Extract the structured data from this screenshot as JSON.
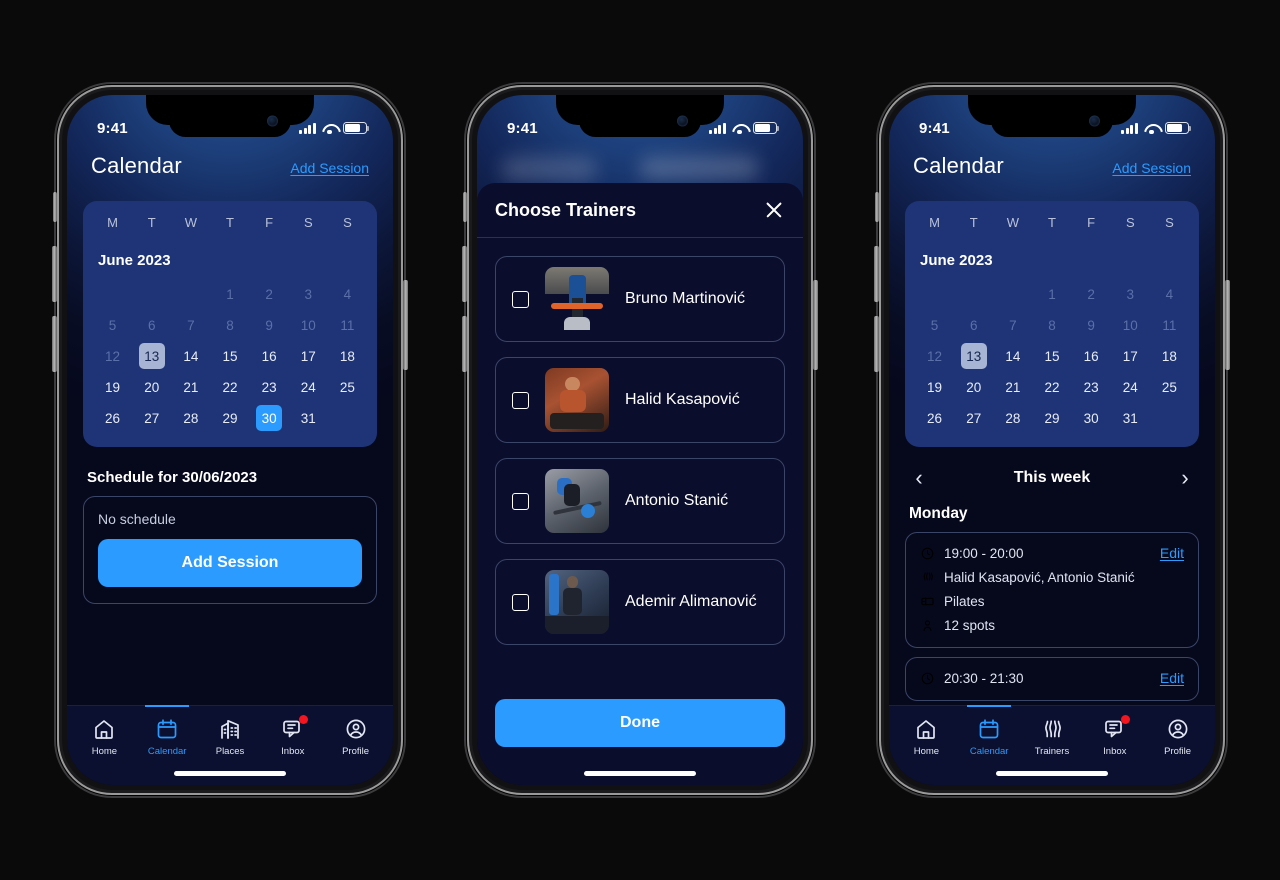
{
  "statusbar": {
    "time": "9:41",
    "signal_icon": "cellular-bars-icon",
    "wifi_icon": "wifi-icon",
    "battery_icon": "battery-icon"
  },
  "phone1": {
    "header": {
      "title": "Calendar",
      "add_session_link": "Add Session"
    },
    "calendar": {
      "weekdays": [
        "M",
        "T",
        "W",
        "T",
        "F",
        "S",
        "S"
      ],
      "month_label": "June 2023",
      "days": [
        {
          "n": "1",
          "state": "past"
        },
        {
          "n": "2",
          "state": "past"
        },
        {
          "n": "3",
          "state": "past"
        },
        {
          "n": "4",
          "state": "past"
        },
        {
          "n": "5",
          "state": "past"
        },
        {
          "n": "6",
          "state": "past"
        },
        {
          "n": "7",
          "state": "past"
        },
        {
          "n": "8",
          "state": "past"
        },
        {
          "n": "9",
          "state": "past"
        },
        {
          "n": "10",
          "state": "past"
        },
        {
          "n": "11",
          "state": "past"
        },
        {
          "n": "12",
          "state": "past"
        },
        {
          "n": "13",
          "state": "today"
        },
        {
          "n": "14",
          "state": "normal"
        },
        {
          "n": "15",
          "state": "normal"
        },
        {
          "n": "16",
          "state": "normal"
        },
        {
          "n": "17",
          "state": "normal"
        },
        {
          "n": "18",
          "state": "normal"
        },
        {
          "n": "19",
          "state": "normal"
        },
        {
          "n": "20",
          "state": "normal"
        },
        {
          "n": "21",
          "state": "normal"
        },
        {
          "n": "22",
          "state": "normal"
        },
        {
          "n": "23",
          "state": "normal"
        },
        {
          "n": "24",
          "state": "normal"
        },
        {
          "n": "25",
          "state": "normal"
        },
        {
          "n": "26",
          "state": "normal"
        },
        {
          "n": "27",
          "state": "normal"
        },
        {
          "n": "28",
          "state": "normal"
        },
        {
          "n": "29",
          "state": "normal"
        },
        {
          "n": "30",
          "state": "sel"
        },
        {
          "n": "31",
          "state": "normal"
        }
      ]
    },
    "schedule": {
      "title": "Schedule for 30/06/2023",
      "empty_text": "No schedule",
      "add_button": "Add Session"
    },
    "tabs": [
      {
        "label": "Home",
        "icon": "home-icon",
        "active": false,
        "badge": false
      },
      {
        "label": "Calendar",
        "icon": "calendar-icon",
        "active": true,
        "badge": false
      },
      {
        "label": "Places",
        "icon": "building-icon",
        "active": false,
        "badge": false
      },
      {
        "label": "Inbox",
        "icon": "chat-icon",
        "active": false,
        "badge": true
      },
      {
        "label": "Profile",
        "icon": "person-circle-icon",
        "active": false,
        "badge": false
      }
    ]
  },
  "phone2": {
    "sheet": {
      "title": "Choose Trainers",
      "close_icon": "close-icon",
      "done_button": "Done",
      "trainers": [
        {
          "name": "Bruno Martinović",
          "checked": false,
          "photo": "trainer-photo-barbell"
        },
        {
          "name": "Halid Kasapović",
          "checked": false,
          "photo": "trainer-photo-bench"
        },
        {
          "name": "Antonio Stanić",
          "checked": false,
          "photo": "trainer-photo-deadlift"
        },
        {
          "name": "Ademir Alimanović",
          "checked": false,
          "photo": "trainer-photo-gym"
        }
      ]
    }
  },
  "phone3": {
    "header": {
      "title": "Calendar",
      "add_session_link": "Add Session"
    },
    "calendar": {
      "weekdays": [
        "M",
        "T",
        "W",
        "T",
        "F",
        "S",
        "S"
      ],
      "month_label": "June 2023",
      "days": [
        {
          "n": "1",
          "state": "past"
        },
        {
          "n": "2",
          "state": "past"
        },
        {
          "n": "3",
          "state": "past"
        },
        {
          "n": "4",
          "state": "past"
        },
        {
          "n": "5",
          "state": "past"
        },
        {
          "n": "6",
          "state": "past"
        },
        {
          "n": "7",
          "state": "past"
        },
        {
          "n": "8",
          "state": "past"
        },
        {
          "n": "9",
          "state": "past"
        },
        {
          "n": "10",
          "state": "past"
        },
        {
          "n": "11",
          "state": "past"
        },
        {
          "n": "12",
          "state": "past"
        },
        {
          "n": "13",
          "state": "today"
        },
        {
          "n": "14",
          "state": "normal"
        },
        {
          "n": "15",
          "state": "normal"
        },
        {
          "n": "16",
          "state": "normal"
        },
        {
          "n": "17",
          "state": "normal"
        },
        {
          "n": "18",
          "state": "normal"
        },
        {
          "n": "19",
          "state": "normal"
        },
        {
          "n": "20",
          "state": "normal"
        },
        {
          "n": "21",
          "state": "normal"
        },
        {
          "n": "22",
          "state": "normal"
        },
        {
          "n": "23",
          "state": "normal"
        },
        {
          "n": "24",
          "state": "normal"
        },
        {
          "n": "25",
          "state": "normal"
        },
        {
          "n": "26",
          "state": "normal"
        },
        {
          "n": "27",
          "state": "normal"
        },
        {
          "n": "28",
          "state": "normal"
        },
        {
          "n": "29",
          "state": "normal"
        },
        {
          "n": "30",
          "state": "normal"
        },
        {
          "n": "31",
          "state": "normal"
        }
      ]
    },
    "week": {
      "prev_icon": "chevron-left-icon",
      "label": "This week",
      "next_icon": "chevron-right-icon"
    },
    "day_label": "Monday",
    "sessions": [
      {
        "time": "19:00 - 20:00",
        "edit_label": "Edit",
        "trainers": "Halid Kasapović, Antonio Stanić",
        "room": "Pilates",
        "spots": "12 spots"
      },
      {
        "time": "20:30 - 21:30",
        "edit_label": "Edit"
      }
    ],
    "tabs": [
      {
        "label": "Home",
        "icon": "home-icon",
        "active": false,
        "badge": false
      },
      {
        "label": "Calendar",
        "icon": "calendar-icon",
        "active": true,
        "badge": false
      },
      {
        "label": "Trainers",
        "icon": "muscle-icon",
        "active": false,
        "badge": false
      },
      {
        "label": "Inbox",
        "icon": "chat-icon",
        "active": false,
        "badge": true
      },
      {
        "label": "Profile",
        "icon": "person-circle-icon",
        "active": false,
        "badge": false
      }
    ]
  },
  "colors": {
    "accent": "#2b9bff",
    "calendar_card": "#1e3476",
    "today_chip": "#a8b4d4",
    "badge_red": "#f5151f",
    "sheet_bg": "#0a0d2c"
  }
}
